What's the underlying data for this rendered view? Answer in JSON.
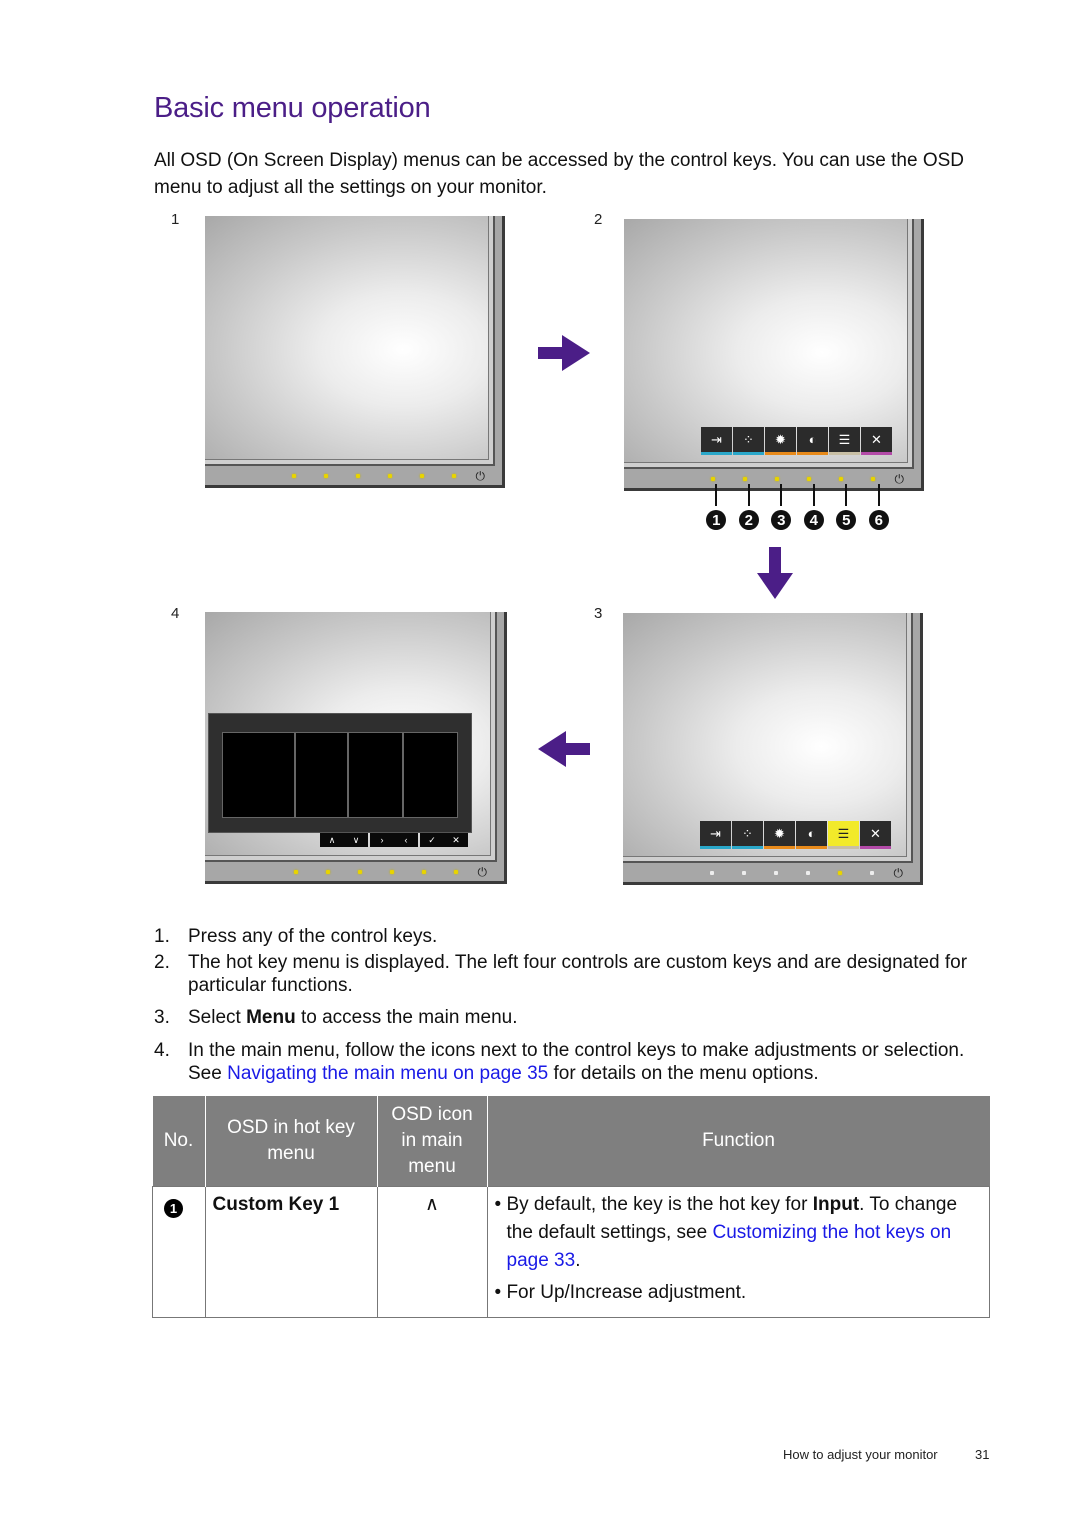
{
  "page": {
    "title": "Basic menu operation",
    "intro": "All OSD (On Screen Display) menus can be accessed by the control keys. You can use the OSD menu to adjust all the settings on your monitor.",
    "accent_color": "#4b1e87",
    "link_color": "#1a1ae6"
  },
  "figure": {
    "panels": [
      {
        "label": "1",
        "state": "idle"
      },
      {
        "label": "2",
        "state": "hot-key-menu"
      },
      {
        "label": "3",
        "state": "hot-key-menu-menu-selected"
      },
      {
        "label": "4",
        "state": "main-menu"
      }
    ],
    "hotkey_icons": [
      {
        "icon": "input-icon",
        "glyph": "⇥",
        "underline_color": "#2aa7c9"
      },
      {
        "icon": "picture-mode-icon",
        "glyph": "⁘",
        "underline_color": "#2aa7c9"
      },
      {
        "icon": "brightness-icon",
        "glyph": "✹",
        "underline_color": "#e88a1a"
      },
      {
        "icon": "contrast-icon",
        "glyph": "◐",
        "underline_color": "#e88a1a"
      },
      {
        "icon": "menu-icon",
        "glyph": "☰",
        "underline_color": "#c8bfa5"
      },
      {
        "icon": "close-icon",
        "glyph": "✕",
        "underline_color": "#b34aa8"
      }
    ],
    "key_numbers": [
      "1",
      "2",
      "3",
      "4",
      "5",
      "6"
    ],
    "main_menu_nav": [
      "∧",
      "∨",
      "›",
      "‹",
      "✓",
      "✕"
    ],
    "power_glyph": "⏻"
  },
  "steps": [
    {
      "n": "1.",
      "text": "Press any of the control keys."
    },
    {
      "n": "2.",
      "text": "The hot key menu is displayed. The left four controls are custom keys and are designated for particular functions."
    },
    {
      "n": "3.",
      "pre": "Select ",
      "bold": "Menu",
      "post": " to access the main menu."
    },
    {
      "n": "4.",
      "pre": "In the main menu, follow the icons next to the control keys to make adjustments or selection. See ",
      "link": "Navigating the main menu on page 35",
      "post": " for details on the menu options."
    }
  ],
  "table": {
    "headers": [
      "No.",
      "OSD in hot key menu",
      "OSD icon in main menu",
      "Function"
    ],
    "rows": [
      {
        "no": "1",
        "osd_hotkey": "Custom Key 1",
        "osd_icon": "∧",
        "function": {
          "b1_pre": "By default, the key is the hot key for ",
          "b1_bold": "Input",
          "b1_mid": ". To change the default settings, see ",
          "b1_link": "Customizing the hot keys on page 33",
          "b1_post": ".",
          "b2": "For Up/Increase adjustment."
        }
      }
    ]
  },
  "footer": {
    "section": "How to adjust your monitor",
    "page_number": "31"
  }
}
